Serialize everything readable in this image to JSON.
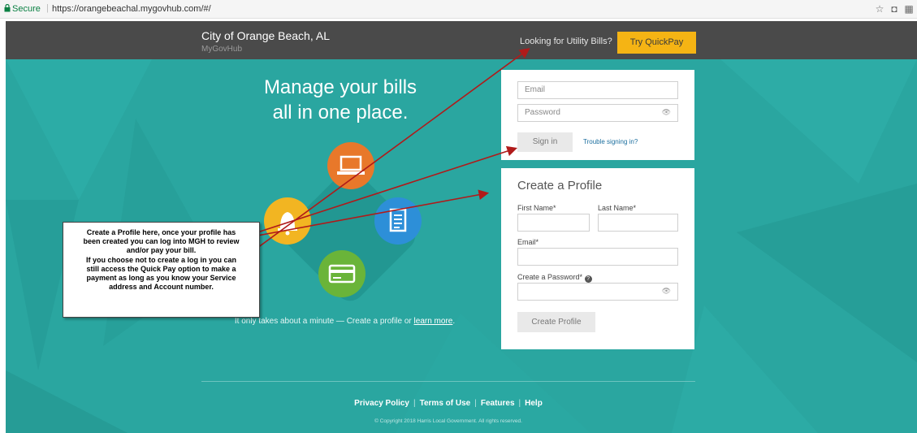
{
  "browser": {
    "secure_label": "Secure",
    "url": "https://orangebeachal.mygovhub.com/#/"
  },
  "header": {
    "brand_title": "City of Orange Beach, AL",
    "brand_subtitle": "MyGovHub",
    "looking_for": "Looking for Utility Bills?",
    "quickpay_label": "Try QuickPay"
  },
  "hero": {
    "line1": "Manage your bills",
    "line2": "all in one place."
  },
  "icons": [
    "laptop-icon",
    "bell-icon",
    "document-icon",
    "credit-card-icon"
  ],
  "signin": {
    "email_placeholder": "Email",
    "password_placeholder": "Password",
    "signin_label": "Sign in",
    "trouble_label": "Trouble signing in?"
  },
  "profile": {
    "title": "Create a Profile",
    "first_name_label": "First Name*",
    "last_name_label": "Last Name*",
    "email_label": "Email*",
    "password_label": "Create a Password*",
    "create_label": "Create Profile"
  },
  "tagline": {
    "text": "It only takes about a minute — Create a profile or ",
    "learn_more": "learn more",
    "end": "."
  },
  "annotation": {
    "line1": "Create a Profile here, once your profile has",
    "line2": "been created you can log into MGH to review",
    "line3": "and/or pay your bill.",
    "line4": "If you choose not to create a log in you can",
    "line5": "still access the Quick Pay option to make a",
    "line6": "payment as long as you know your Service",
    "line7": "address and Account number."
  },
  "footer": {
    "privacy": "Privacy Policy",
    "terms": "Terms of Use",
    "features": "Features",
    "help": "Help",
    "copyright": "© Copyright 2018 Harris Local Government. All rights reserved."
  },
  "colors": {
    "teal": "#2aa6a0",
    "header": "#4a4a4a",
    "quickpay": "#f5b414",
    "arrow": "#b01a1a"
  }
}
